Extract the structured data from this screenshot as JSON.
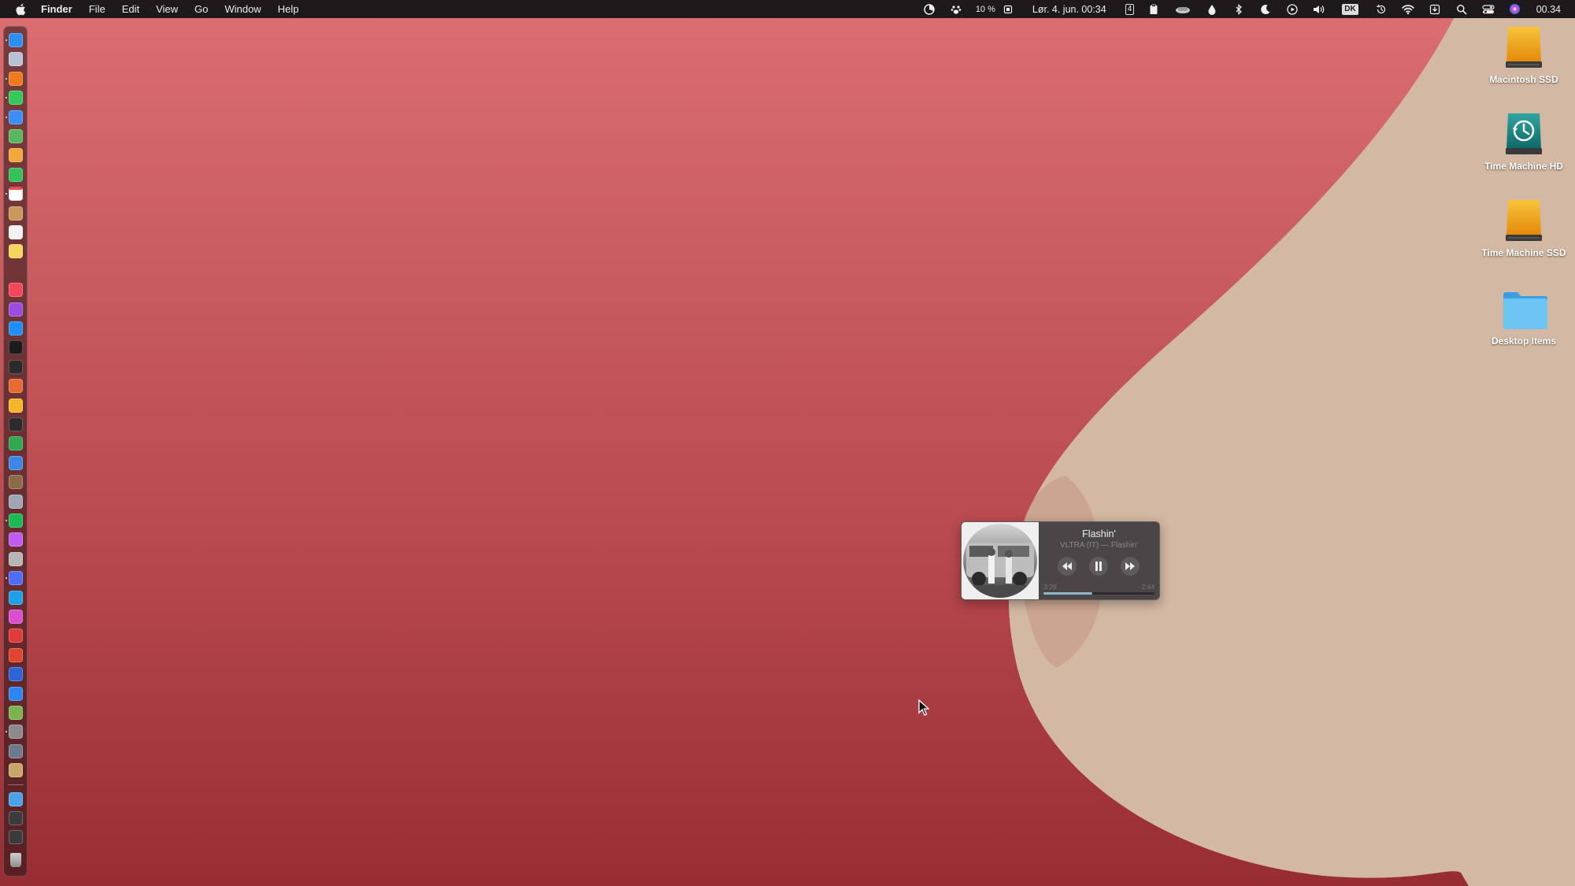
{
  "menubar": {
    "app_name": "Finder",
    "menus": [
      "File",
      "Edit",
      "View",
      "Go",
      "Window",
      "Help"
    ],
    "cpu_text": "10 %",
    "date_time": "Lør. 4. jun.  00:34",
    "calendar_badge": "4",
    "input_source": "DK",
    "clock_right": "00.34",
    "status_icons": [
      "stats-icon",
      "paw-icon",
      "cpu-chip-icon",
      "calendar-icon",
      "clipboard-icon",
      "coffee-icon",
      "drop-icon",
      "bluetooth-icon",
      "moon-icon",
      "play-icon",
      "volume-icon",
      "input-source-icon",
      "time-machine-icon",
      "wifi-icon",
      "download-icon",
      "search-icon",
      "control-center-icon",
      "siri-icon"
    ]
  },
  "desktop": {
    "items": [
      {
        "label": "Macintosh SSD",
        "icon": "external-drive-icon"
      },
      {
        "label": "Time Machine HD",
        "icon": "time-machine-drive-icon"
      },
      {
        "label": "Time Machine SSD",
        "icon": "external-drive-icon"
      },
      {
        "label": "Desktop Items",
        "icon": "folder-icon"
      }
    ]
  },
  "player": {
    "title": "Flashin'",
    "subtitle": "VLTRA (IT) — Flashin'",
    "elapsed": "3:29",
    "remaining": "- 2:44",
    "progress": 0.44,
    "controls": [
      "rewind-icon",
      "pause-icon",
      "fast-forward-icon"
    ]
  },
  "dock": {
    "apps": [
      {
        "name": "finder-icon",
        "color": "#2f8ff0"
      },
      {
        "name": "launchpad-icon",
        "color": "#b7c3d4"
      },
      {
        "name": "firefox-icon",
        "color": "#f07a1e"
      },
      {
        "name": "messages-icon",
        "color": "#36c95a"
      },
      {
        "name": "mail-icon",
        "color": "#3a8ef5"
      },
      {
        "name": "maps-icon",
        "color": "#5bb75e"
      },
      {
        "name": "photos-icon",
        "color": "#f2a83b"
      },
      {
        "name": "facetime-icon",
        "color": "#32c15a"
      },
      {
        "name": "calendar-icon",
        "color": "#ffffff"
      },
      {
        "name": "contacts-icon",
        "color": "#c79a5b"
      },
      {
        "name": "reminders-icon",
        "color": "#f2f2f2"
      },
      {
        "name": "notes-icon",
        "color": "#f6d55c"
      },
      {
        "name": "tv-icon",
        "color": "#1a1a1a"
      },
      {
        "name": "music-icon",
        "color": "#f34759"
      },
      {
        "name": "podcasts-icon",
        "color": "#9b4de0"
      },
      {
        "name": "app-store-icon",
        "color": "#1f8ef7"
      },
      {
        "name": "terminal-icon",
        "color": "#1c1c1c"
      },
      {
        "name": "voice-memos-icon",
        "color": "#2a2a2a"
      },
      {
        "name": "pixelmator-icon",
        "color": "#e86b34"
      },
      {
        "name": "sketch-icon",
        "color": "#f5b72a"
      },
      {
        "name": "screen-recorder-icon",
        "color": "#2b2b2b"
      },
      {
        "name": "globe-icon",
        "color": "#2fa84f"
      },
      {
        "name": "network-icon",
        "color": "#3c86e6"
      },
      {
        "name": "finder-cat-icon",
        "color": "#8a6a4a"
      },
      {
        "name": "system-info-icon",
        "color": "#9ea6b3"
      },
      {
        "name": "spotify-icon",
        "color": "#1db954"
      },
      {
        "name": "gradient-app-icon",
        "color": "#c05cf2"
      },
      {
        "name": "gems-icon",
        "color": "#b6b6b6"
      },
      {
        "name": "messenger-icon",
        "color": "#4f6ef7"
      },
      {
        "name": "sync-icon",
        "color": "#1fa1e8"
      },
      {
        "name": "flower-icon",
        "color": "#d94fd0"
      },
      {
        "name": "red-app-icon",
        "color": "#e03a3a"
      },
      {
        "name": "trophy-app-icon",
        "color": "#e2452d"
      },
      {
        "name": "arrow-app-icon",
        "color": "#2b65d8"
      },
      {
        "name": "xcode-icon",
        "color": "#2d86f0"
      },
      {
        "name": "script-editor-icon",
        "color": "#7bb350"
      },
      {
        "name": "settings-gear-icon",
        "color": "#8a8a8a"
      },
      {
        "name": "disk-utility-icon",
        "color": "#6d7a8c"
      },
      {
        "name": "archive-icon",
        "color": "#c7a66a"
      },
      {
        "name": "downloads-folder-icon",
        "color": "#4aa3e8"
      },
      {
        "name": "recent-doc-icon",
        "color": "#3b3b3b"
      },
      {
        "name": "recent-doc-2-icon",
        "color": "#3b3b3b"
      },
      {
        "name": "trash-icon",
        "color": "#a9a9a9"
      }
    ]
  },
  "colors": {
    "wallpaper_top": "#dc6e70",
    "wallpaper_bottom": "#972d33",
    "blob": "#d3b8a3",
    "menubar": "#1e1a1b",
    "progress": "#8fb7c9"
  }
}
